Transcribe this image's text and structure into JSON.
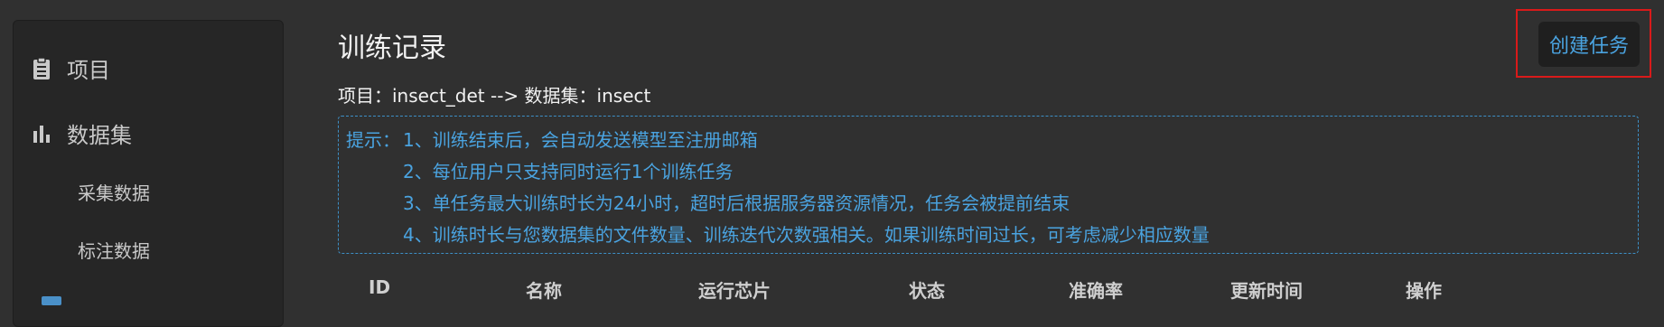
{
  "sidebar": {
    "items": [
      {
        "label": "项目",
        "icon": "clipboard-icon"
      },
      {
        "label": "数据集",
        "icon": "bar-chart-icon"
      }
    ],
    "sub_items": [
      {
        "label": "采集数据"
      },
      {
        "label": "标注数据"
      }
    ]
  },
  "main": {
    "title": "训练记录",
    "breadcrumb": "项目：insect_det --> 数据集：insect",
    "create_button": "创建任务",
    "tips": {
      "prefix": "提示：",
      "lines": [
        "1、训练结束后，会自动发送模型至注册邮箱",
        "2、每位用户只支持同时运行1个训练任务",
        "3、单任务最大训练时长为24小时，超时后根据服务器资源情况，任务会被提前结束",
        "4、训练时长与您数据集的文件数量、训练迭代次数强相关。如果训练时间过长，可考虑减少相应数量"
      ]
    },
    "table": {
      "columns": [
        "ID",
        "名称",
        "运行芯片",
        "状态",
        "准确率",
        "更新时间",
        "操作"
      ]
    }
  },
  "colors": {
    "background": "#303030",
    "sidebar": "#262626",
    "accent": "#4aa3e0",
    "highlight_border": "#d91a1a"
  }
}
